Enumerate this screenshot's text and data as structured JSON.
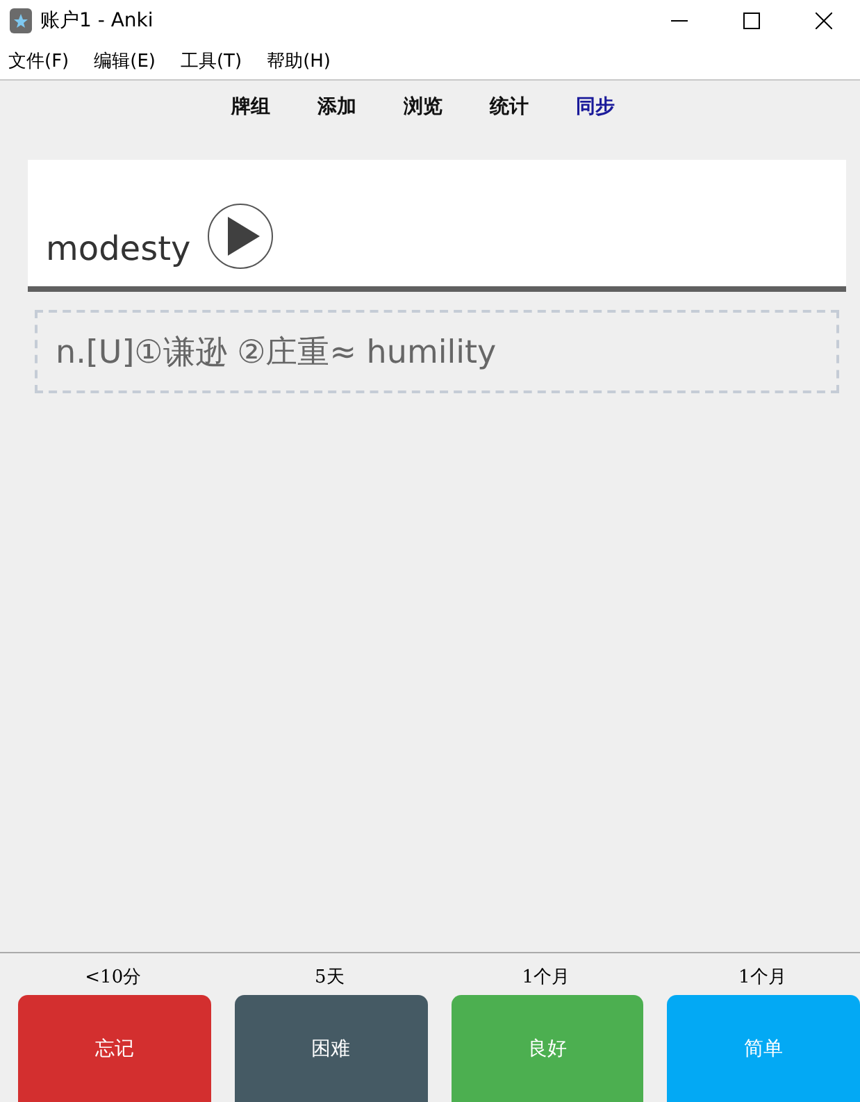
{
  "window": {
    "title": "账户1 - Anki"
  },
  "menu": [
    "文件(F)",
    "编辑(E)",
    "工具(T)",
    "帮助(H)"
  ],
  "toolbar": [
    {
      "label": "牌组",
      "selected": false
    },
    {
      "label": "添加",
      "selected": false
    },
    {
      "label": "浏览",
      "selected": false
    },
    {
      "label": "统计",
      "selected": false
    },
    {
      "label": "同步",
      "selected": true
    }
  ],
  "card": {
    "front": "modesty",
    "answer": "n.[U]①谦逊 ②庄重≈ humility"
  },
  "answers": [
    {
      "interval": "<10分",
      "label": "忘记",
      "color": "#d32f2f"
    },
    {
      "interval": "5天",
      "label": "困难",
      "color": "#455a64"
    },
    {
      "interval": "1个月",
      "label": "良好",
      "color": "#4caf50"
    },
    {
      "interval": "1个月",
      "label": "简单",
      "color": "#03a9f4"
    }
  ]
}
